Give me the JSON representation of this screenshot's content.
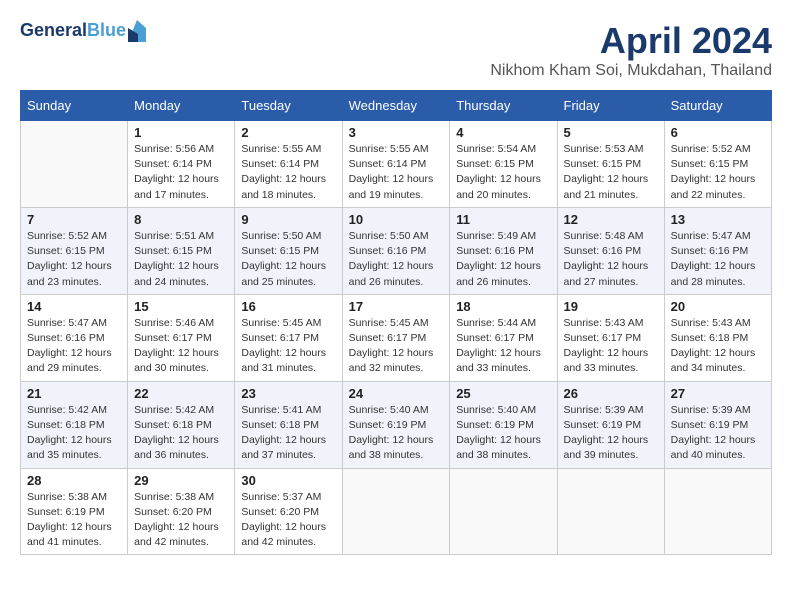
{
  "header": {
    "logo_line1": "General",
    "logo_line2": "Blue",
    "month": "April 2024",
    "location": "Nikhom Kham Soi, Mukdahan, Thailand"
  },
  "weekdays": [
    "Sunday",
    "Monday",
    "Tuesday",
    "Wednesday",
    "Thursday",
    "Friday",
    "Saturday"
  ],
  "weeks": [
    [
      {
        "day": "",
        "info": ""
      },
      {
        "day": "1",
        "info": "Sunrise: 5:56 AM\nSunset: 6:14 PM\nDaylight: 12 hours\nand 17 minutes."
      },
      {
        "day": "2",
        "info": "Sunrise: 5:55 AM\nSunset: 6:14 PM\nDaylight: 12 hours\nand 18 minutes."
      },
      {
        "day": "3",
        "info": "Sunrise: 5:55 AM\nSunset: 6:14 PM\nDaylight: 12 hours\nand 19 minutes."
      },
      {
        "day": "4",
        "info": "Sunrise: 5:54 AM\nSunset: 6:15 PM\nDaylight: 12 hours\nand 20 minutes."
      },
      {
        "day": "5",
        "info": "Sunrise: 5:53 AM\nSunset: 6:15 PM\nDaylight: 12 hours\nand 21 minutes."
      },
      {
        "day": "6",
        "info": "Sunrise: 5:52 AM\nSunset: 6:15 PM\nDaylight: 12 hours\nand 22 minutes."
      }
    ],
    [
      {
        "day": "7",
        "info": "Sunrise: 5:52 AM\nSunset: 6:15 PM\nDaylight: 12 hours\nand 23 minutes."
      },
      {
        "day": "8",
        "info": "Sunrise: 5:51 AM\nSunset: 6:15 PM\nDaylight: 12 hours\nand 24 minutes."
      },
      {
        "day": "9",
        "info": "Sunrise: 5:50 AM\nSunset: 6:15 PM\nDaylight: 12 hours\nand 25 minutes."
      },
      {
        "day": "10",
        "info": "Sunrise: 5:50 AM\nSunset: 6:16 PM\nDaylight: 12 hours\nand 26 minutes."
      },
      {
        "day": "11",
        "info": "Sunrise: 5:49 AM\nSunset: 6:16 PM\nDaylight: 12 hours\nand 26 minutes."
      },
      {
        "day": "12",
        "info": "Sunrise: 5:48 AM\nSunset: 6:16 PM\nDaylight: 12 hours\nand 27 minutes."
      },
      {
        "day": "13",
        "info": "Sunrise: 5:47 AM\nSunset: 6:16 PM\nDaylight: 12 hours\nand 28 minutes."
      }
    ],
    [
      {
        "day": "14",
        "info": "Sunrise: 5:47 AM\nSunset: 6:16 PM\nDaylight: 12 hours\nand 29 minutes."
      },
      {
        "day": "15",
        "info": "Sunrise: 5:46 AM\nSunset: 6:17 PM\nDaylight: 12 hours\nand 30 minutes."
      },
      {
        "day": "16",
        "info": "Sunrise: 5:45 AM\nSunset: 6:17 PM\nDaylight: 12 hours\nand 31 minutes."
      },
      {
        "day": "17",
        "info": "Sunrise: 5:45 AM\nSunset: 6:17 PM\nDaylight: 12 hours\nand 32 minutes."
      },
      {
        "day": "18",
        "info": "Sunrise: 5:44 AM\nSunset: 6:17 PM\nDaylight: 12 hours\nand 33 minutes."
      },
      {
        "day": "19",
        "info": "Sunrise: 5:43 AM\nSunset: 6:17 PM\nDaylight: 12 hours\nand 33 minutes."
      },
      {
        "day": "20",
        "info": "Sunrise: 5:43 AM\nSunset: 6:18 PM\nDaylight: 12 hours\nand 34 minutes."
      }
    ],
    [
      {
        "day": "21",
        "info": "Sunrise: 5:42 AM\nSunset: 6:18 PM\nDaylight: 12 hours\nand 35 minutes."
      },
      {
        "day": "22",
        "info": "Sunrise: 5:42 AM\nSunset: 6:18 PM\nDaylight: 12 hours\nand 36 minutes."
      },
      {
        "day": "23",
        "info": "Sunrise: 5:41 AM\nSunset: 6:18 PM\nDaylight: 12 hours\nand 37 minutes."
      },
      {
        "day": "24",
        "info": "Sunrise: 5:40 AM\nSunset: 6:19 PM\nDaylight: 12 hours\nand 38 minutes."
      },
      {
        "day": "25",
        "info": "Sunrise: 5:40 AM\nSunset: 6:19 PM\nDaylight: 12 hours\nand 38 minutes."
      },
      {
        "day": "26",
        "info": "Sunrise: 5:39 AM\nSunset: 6:19 PM\nDaylight: 12 hours\nand 39 minutes."
      },
      {
        "day": "27",
        "info": "Sunrise: 5:39 AM\nSunset: 6:19 PM\nDaylight: 12 hours\nand 40 minutes."
      }
    ],
    [
      {
        "day": "28",
        "info": "Sunrise: 5:38 AM\nSunset: 6:19 PM\nDaylight: 12 hours\nand 41 minutes."
      },
      {
        "day": "29",
        "info": "Sunrise: 5:38 AM\nSunset: 6:20 PM\nDaylight: 12 hours\nand 42 minutes."
      },
      {
        "day": "30",
        "info": "Sunrise: 5:37 AM\nSunset: 6:20 PM\nDaylight: 12 hours\nand 42 minutes."
      },
      {
        "day": "",
        "info": ""
      },
      {
        "day": "",
        "info": ""
      },
      {
        "day": "",
        "info": ""
      },
      {
        "day": "",
        "info": ""
      }
    ]
  ]
}
